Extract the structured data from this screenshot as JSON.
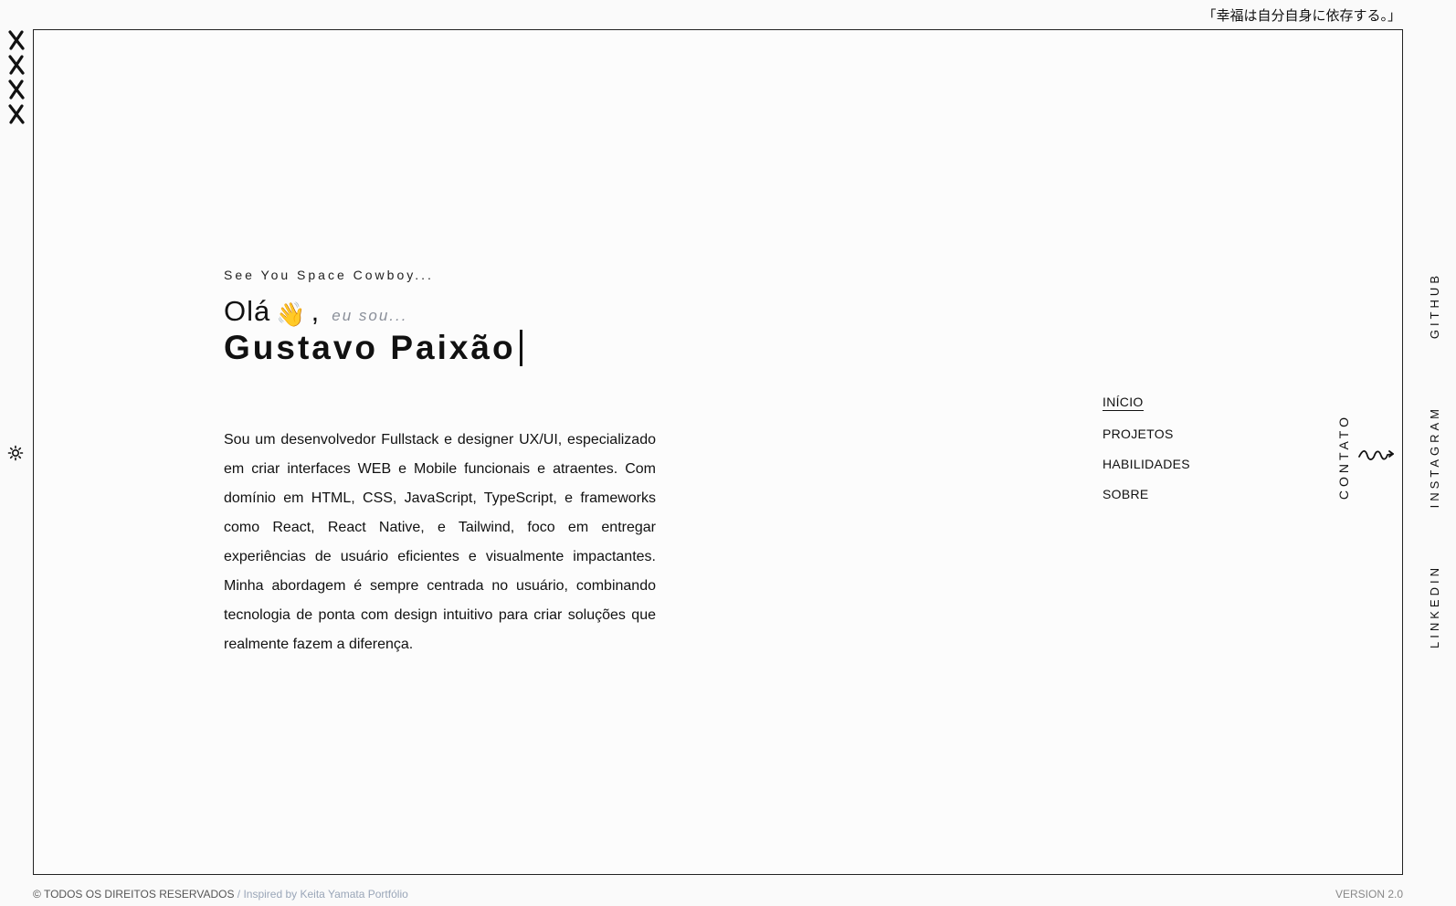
{
  "quote": "「幸福は自分自身に依存する。」",
  "left_marks": [
    "x-mark-icon",
    "x-mark-icon",
    "x-mark-icon",
    "x-mark-icon"
  ],
  "theme_toggle_icon": "sun-icon",
  "hero": {
    "tagline": "See You Space Cowboy...",
    "hello": "Olá",
    "wave_emoji": "👋",
    "comma": ",",
    "eu_sou": "eu sou...",
    "name": "Gustavo Paixão"
  },
  "bio": "Sou um desenvolvedor Fullstack e designer UX/UI, especializado em criar interfaces WEB e Mobile funcionais e atraentes. Com domínio em HTML, CSS, JavaScript, TypeScript, e frameworks como React, React Native, e Tailwind, foco em entregar experiências de usuário eficientes e visualmente impactantes. Minha abordagem é sempre centrada no usuário, combinando tecnologia de ponta com design intuitivo para criar soluções que realmente fazem a diferença.",
  "nav": {
    "items": [
      "INÍCIO",
      "PROJETOS",
      "HABILIDADES",
      "SOBRE"
    ],
    "active": "INÍCIO"
  },
  "contato": "CONTATO",
  "social": {
    "github": "GITHUB",
    "instagram": "INSTAGRAM",
    "linkedin": "LINKEDIN"
  },
  "footer": {
    "copyright": "© TODOS OS DIREITOS RESERVADOS",
    "inspired": " / Inspired by Keita Yamata Portfólio",
    "version": "VERSION 2.0"
  }
}
